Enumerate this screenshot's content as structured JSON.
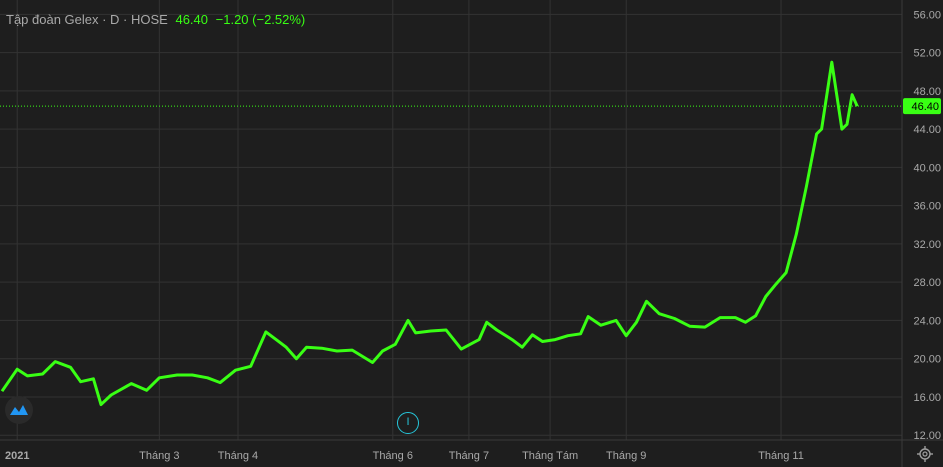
{
  "legend": {
    "symbol": "Tập đoàn Gelex · D · HOSE",
    "last": "46.40",
    "change": "−1.20 (−2.52%)"
  },
  "price_label": "46.40",
  "event_marker": "I",
  "colors": {
    "line": "#39ff14",
    "background": "#1e1e1e",
    "grid": "#333333",
    "text": "#a9a9a9",
    "marker": "#26c6da"
  },
  "icons": {
    "logo": "tradingview-logo-icon",
    "settings": "gear-icon",
    "event": "event-marker-icon"
  },
  "chart_data": {
    "type": "line",
    "title": "Tập đoàn Gelex · D · HOSE",
    "ylim": [
      11.5,
      57.5
    ],
    "y_ticks": [
      "56.00",
      "52.00",
      "48.00",
      "44.00",
      "40.00",
      "36.00",
      "32.00",
      "28.00",
      "24.00",
      "20.00",
      "16.00",
      "12.00"
    ],
    "x_range": [
      "2020-12-29",
      "2021-12-10"
    ],
    "x_ticks": [
      {
        "label": "2021",
        "date": "2021-01-04"
      },
      {
        "label": "Tháng 3",
        "date": "2021-03-01"
      },
      {
        "label": "Tháng 4",
        "date": "2021-04-01"
      },
      {
        "label": "Tháng 6",
        "date": "2021-06-01"
      },
      {
        "label": "Tháng 7",
        "date": "2021-07-01"
      },
      {
        "label": "Tháng Tám",
        "date": "2021-08-02"
      },
      {
        "label": "Tháng 9",
        "date": "2021-09-01"
      },
      {
        "label": "Tháng 11",
        "date": "2021-11-01"
      }
    ],
    "grid": true,
    "last_value": 46.4,
    "series": [
      {
        "values": [
          [
            "2020-12-29",
            16.6
          ],
          [
            "2021-01-04",
            18.9
          ],
          [
            "2021-01-08",
            18.2
          ],
          [
            "2021-01-14",
            18.4
          ],
          [
            "2021-01-19",
            19.7
          ],
          [
            "2021-01-25",
            19.1
          ],
          [
            "2021-01-29",
            17.6
          ],
          [
            "2021-02-03",
            17.9
          ],
          [
            "2021-02-06",
            15.2
          ],
          [
            "2021-02-10",
            16.2
          ],
          [
            "2021-02-18",
            17.4
          ],
          [
            "2021-02-24",
            16.7
          ],
          [
            "2021-03-01",
            18.0
          ],
          [
            "2021-03-08",
            18.3
          ],
          [
            "2021-03-14",
            18.3
          ],
          [
            "2021-03-20",
            18.0
          ],
          [
            "2021-03-25",
            17.5
          ],
          [
            "2021-03-31",
            18.8
          ],
          [
            "2021-04-06",
            19.2
          ],
          [
            "2021-04-12",
            22.8
          ],
          [
            "2021-04-16",
            22.0
          ],
          [
            "2021-04-20",
            21.2
          ],
          [
            "2021-04-24",
            20.0
          ],
          [
            "2021-04-28",
            21.2
          ],
          [
            "2021-05-04",
            21.1
          ],
          [
            "2021-05-10",
            20.8
          ],
          [
            "2021-05-16",
            20.9
          ],
          [
            "2021-05-24",
            19.6
          ],
          [
            "2021-05-28",
            20.8
          ],
          [
            "2021-06-02",
            21.5
          ],
          [
            "2021-06-07",
            24.0
          ],
          [
            "2021-06-10",
            22.7
          ],
          [
            "2021-06-16",
            22.9
          ],
          [
            "2021-06-22",
            23.0
          ],
          [
            "2021-06-28",
            21.0
          ],
          [
            "2021-07-05",
            22.0
          ],
          [
            "2021-07-08",
            23.8
          ],
          [
            "2021-07-12",
            23.0
          ],
          [
            "2021-07-18",
            22.0
          ],
          [
            "2021-07-22",
            21.2
          ],
          [
            "2021-07-26",
            22.5
          ],
          [
            "2021-07-30",
            21.8
          ],
          [
            "2021-08-04",
            22.0
          ],
          [
            "2021-08-09",
            22.4
          ],
          [
            "2021-08-14",
            22.6
          ],
          [
            "2021-08-17",
            24.4
          ],
          [
            "2021-08-22",
            23.5
          ],
          [
            "2021-08-28",
            24.0
          ],
          [
            "2021-09-01",
            22.4
          ],
          [
            "2021-09-05",
            23.8
          ],
          [
            "2021-09-09",
            26.0
          ],
          [
            "2021-09-14",
            24.7
          ],
          [
            "2021-09-20",
            24.2
          ],
          [
            "2021-09-26",
            23.4
          ],
          [
            "2021-10-02",
            23.3
          ],
          [
            "2021-10-08",
            24.3
          ],
          [
            "2021-10-14",
            24.3
          ],
          [
            "2021-10-18",
            23.8
          ],
          [
            "2021-10-22",
            24.5
          ],
          [
            "2021-10-26",
            26.5
          ],
          [
            "2021-10-30",
            27.8
          ],
          [
            "2021-11-03",
            29.0
          ],
          [
            "2021-11-07",
            33.0
          ],
          [
            "2021-11-11",
            38.0
          ],
          [
            "2021-11-15",
            43.5
          ],
          [
            "2021-11-17",
            44.0
          ],
          [
            "2021-11-21",
            51.0
          ],
          [
            "2021-11-25",
            44.0
          ],
          [
            "2021-11-27",
            44.5
          ],
          [
            "2021-11-29",
            47.6
          ],
          [
            "2021-12-01",
            46.4
          ]
        ]
      }
    ]
  }
}
